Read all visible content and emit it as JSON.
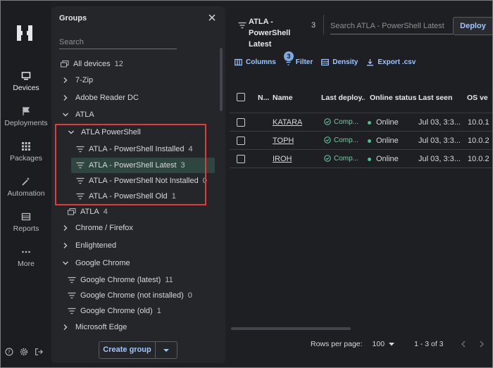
{
  "rail": {
    "items": [
      {
        "label": "Devices",
        "icon": "monitor-icon",
        "active": true
      },
      {
        "label": "Deployments",
        "icon": "flag-icon"
      },
      {
        "label": "Packages",
        "icon": "grid-icon"
      },
      {
        "label": "Automation",
        "icon": "wand-icon"
      },
      {
        "label": "Reports",
        "icon": "reports-icon"
      },
      {
        "label": "More",
        "icon": "more-icon"
      }
    ]
  },
  "groups": {
    "title": "Groups",
    "search_placeholder": "Search",
    "tree": [
      {
        "label": "All devices",
        "count": "12"
      },
      {
        "label": "7-Zip"
      },
      {
        "label": "Adobe Reader DC"
      },
      {
        "label": "ATLA"
      },
      {
        "label": "ATLA PowerShell"
      },
      {
        "label": "ATLA - PowerShell Installed",
        "count": "4"
      },
      {
        "label": "ATLA - PowerShell Latest",
        "count": "3"
      },
      {
        "label": "ATLA - PowerShell Not Installed",
        "count": "0"
      },
      {
        "label": "ATLA - PowerShell Old",
        "count": "1"
      },
      {
        "label": "ATLA",
        "count": "4"
      },
      {
        "label": "Chrome / Firefox"
      },
      {
        "label": "Enlightened"
      },
      {
        "label": "Google Chrome"
      },
      {
        "label": "Google Chrome (latest)",
        "count": "11"
      },
      {
        "label": "Google Chrome (not installed)",
        "count": "0"
      },
      {
        "label": "Google Chrome (old)",
        "count": "1"
      },
      {
        "label": "Microsoft Edge"
      }
    ],
    "create_label": "Create group"
  },
  "main": {
    "title": "ATLA - PowerShell Latest",
    "count": "3",
    "search_placeholder": "Search ATLA - PowerShell Latest",
    "deploy_label": "Deploy",
    "toolbar": {
      "columns": "Columns",
      "filter": "Filter",
      "filter_badge": "3",
      "density": "Density",
      "export": "Export .csv"
    },
    "table": {
      "headers": [
        "N...",
        "Name",
        "Last deploy...",
        "Online status",
        "Last seen",
        "OS ve"
      ],
      "rows": [
        {
          "name": "KATARA",
          "deploy": "Comp...",
          "online": "Online",
          "seen": "Jul 03, 3:3...",
          "os": "10.0.1"
        },
        {
          "name": "TOPH",
          "deploy": "Comp...",
          "online": "Online",
          "seen": "Jul 03, 3:3...",
          "os": "10.0.2"
        },
        {
          "name": "IROH",
          "deploy": "Comp...",
          "online": "Online",
          "seen": "Jul 03, 3:3...",
          "os": "10.0.2"
        }
      ]
    },
    "pager": {
      "rows_label": "Rows per page:",
      "rows_value": "100",
      "range": "1 - 3 of 3"
    }
  },
  "colors": {
    "accent": "#9fc6ff",
    "highlight": "#e23b3b",
    "online": "#4fc18f"
  }
}
